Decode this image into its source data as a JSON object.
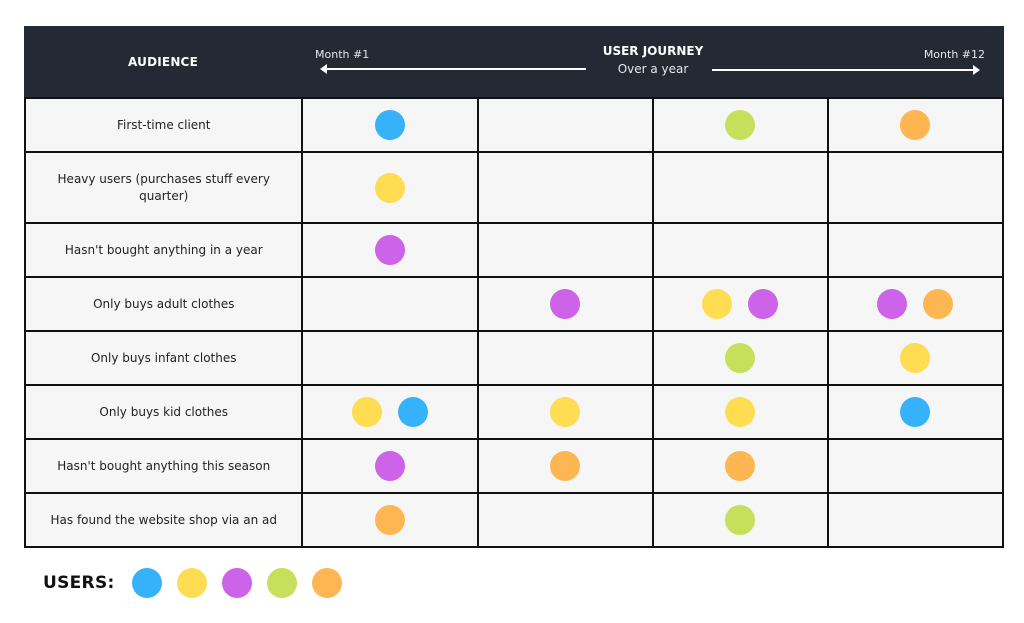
{
  "header": {
    "audience_label": "AUDIENCE",
    "journey_title": "USER JOURNEY",
    "journey_subtitle": "Over a year",
    "start_label": "Month #1",
    "end_label": "Month #12"
  },
  "colors": {
    "blue": "#36b2fb",
    "yellow": "#fedd52",
    "purple": "#cc63e8",
    "green": "#c7e05b",
    "orange": "#feb653"
  },
  "rows": [
    {
      "label": "First-time client",
      "cells": [
        [
          "blue"
        ],
        [],
        [
          "green"
        ],
        [
          "orange"
        ]
      ]
    },
    {
      "label": "Heavy users (purchases stuff every quarter)",
      "cells": [
        [
          "yellow"
        ],
        [],
        [],
        []
      ]
    },
    {
      "label": "Hasn't bought anything in a year",
      "cells": [
        [
          "purple"
        ],
        [],
        [],
        []
      ]
    },
    {
      "label": "Only buys adult clothes",
      "cells": [
        [],
        [
          "purple"
        ],
        [
          "yellow",
          "purple"
        ],
        [
          "purple",
          "orange"
        ]
      ]
    },
    {
      "label": "Only buys infant clothes",
      "cells": [
        [],
        [],
        [
          "green"
        ],
        [
          "yellow"
        ]
      ]
    },
    {
      "label": "Only buys kid clothes",
      "cells": [
        [
          "yellow",
          "blue"
        ],
        [
          "yellow"
        ],
        [
          "yellow"
        ],
        [
          "blue"
        ]
      ]
    },
    {
      "label": "Hasn't bought anything this season",
      "cells": [
        [
          "purple"
        ],
        [
          "orange"
        ],
        [
          "orange"
        ],
        []
      ]
    },
    {
      "label": "Has found the website shop via an ad",
      "cells": [
        [
          "orange"
        ],
        [],
        [
          "green"
        ],
        []
      ]
    }
  ],
  "legend": {
    "label": "USERS:",
    "users": [
      "blue",
      "yellow",
      "purple",
      "green",
      "orange"
    ]
  }
}
